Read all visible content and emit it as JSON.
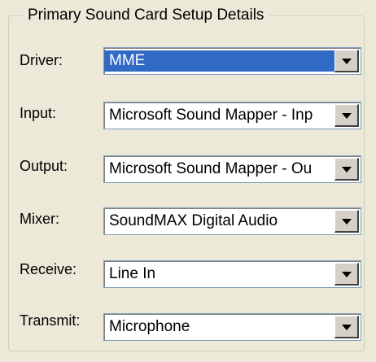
{
  "group": {
    "title": "Primary Sound Card Setup Details"
  },
  "fields": [
    {
      "label": "Driver:",
      "value": "MME",
      "icon": "chevron-down-icon"
    },
    {
      "label": "Input:",
      "value": "Microsoft Sound Mapper - Inp",
      "icon": "chevron-down-icon"
    },
    {
      "label": "Output:",
      "value": "Microsoft Sound Mapper - Ou",
      "icon": "chevron-down-icon"
    },
    {
      "label": "Mixer:",
      "value": "SoundMAX Digital Audio",
      "icon": "chevron-down-icon"
    },
    {
      "label": "Receive:",
      "value": "Line In",
      "icon": "chevron-down-icon"
    },
    {
      "label": "Transmit:",
      "value": "Microphone",
      "icon": "chevron-down-icon"
    }
  ],
  "colors": {
    "window_bg": "#ECE9D8",
    "selection_bg": "#316AC5",
    "selection_text": "#FFFFFF",
    "combo_border": "#7F9DB9"
  }
}
